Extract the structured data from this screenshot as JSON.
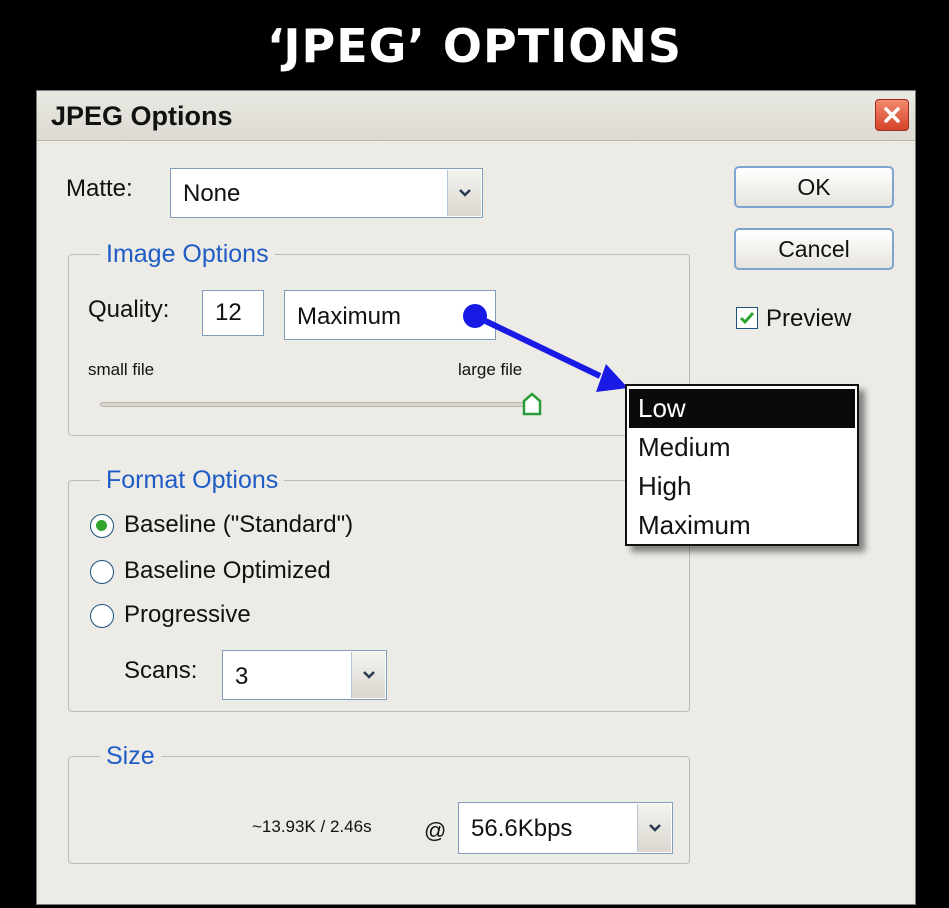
{
  "banner": {
    "title": "‘JPEG’ OPTIONS"
  },
  "window": {
    "title": "JPEG Options"
  },
  "matte": {
    "label": "Matte:",
    "value": "None"
  },
  "buttons": {
    "ok": "OK",
    "cancel": "Cancel"
  },
  "preview": {
    "label": "Preview",
    "checked": true
  },
  "image_options": {
    "legend": "Image Options",
    "quality_label": "Quality:",
    "quality_value": "12",
    "quality_preset": "Maximum",
    "slider_left_label": "small file",
    "slider_right_label": "large file",
    "slider_level": 1.0
  },
  "quality_dropdown": {
    "options": [
      "Low",
      "Medium",
      "High",
      "Maximum"
    ],
    "highlighted": "Low"
  },
  "format_options": {
    "legend": "Format Options",
    "options": [
      "Baseline (\"Standard\")",
      "Baseline Optimized",
      "Progressive"
    ],
    "selected": "Baseline (\"Standard\")",
    "scans_label": "Scans:",
    "scans_value": "3"
  },
  "size": {
    "legend": "Size",
    "estimate": "~13.93K / 2.46s",
    "at": "@",
    "speed": "56.6Kbps"
  },
  "colors": {
    "accent_blue": "#1f5cc6",
    "annotation_arrow": "#1a1ae6",
    "radio_selected": "#2fa52f"
  },
  "icons": [
    "close-icon",
    "chevron-down-icon",
    "checkmark-icon",
    "slider-thumb-icon"
  ]
}
